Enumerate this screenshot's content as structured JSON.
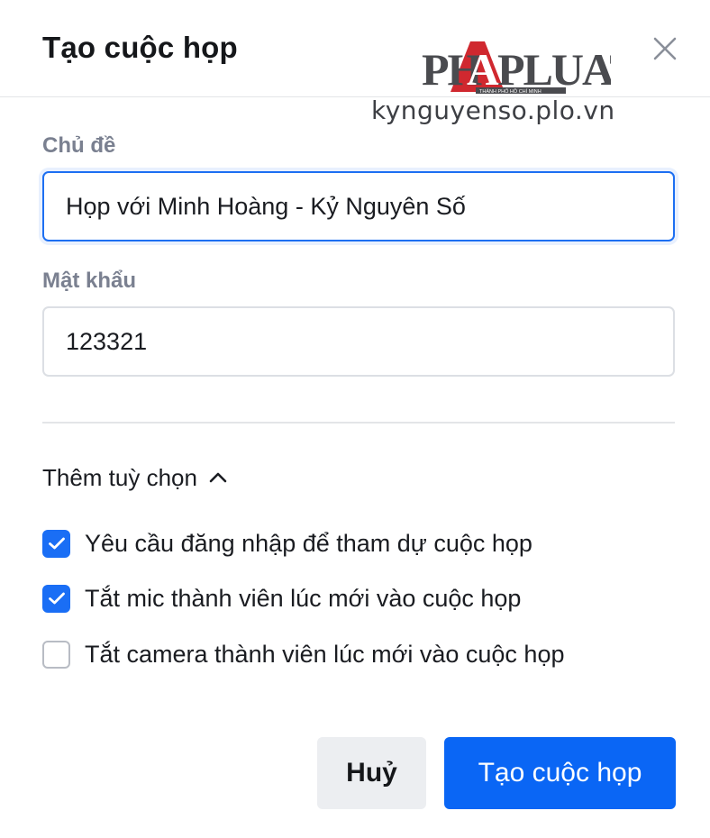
{
  "dialog": {
    "title": "Tạo cuộc họp",
    "close_icon": "close-icon"
  },
  "watermark": {
    "logo_text": "PHÁPLUẬT",
    "logo_subtext": "THÀNH PHỐ HỒ CHÍ MINH",
    "url": "kynguyenso.plo.vn"
  },
  "form": {
    "topic": {
      "label": "Chủ đề",
      "value": "Họp với Minh Hoàng - Kỷ Nguyên Số"
    },
    "password": {
      "label": "Mật khẩu",
      "value": "123321"
    }
  },
  "more_options": {
    "label": "Thêm tuỳ chọn",
    "icon": "chevron-up-icon",
    "options": [
      {
        "label": "Yêu cầu đăng nhập để tham dự cuộc họp",
        "checked": true
      },
      {
        "label": "Tắt mic thành viên lúc mới vào cuộc họp",
        "checked": true
      },
      {
        "label": "Tắt camera thành viên lúc mới vào cuộc họp",
        "checked": false
      }
    ]
  },
  "actions": {
    "cancel_label": "Huỷ",
    "create_label": "Tạo cuộc họp"
  },
  "colors": {
    "primary": "#0a66f5",
    "checkbox_checked": "#1a6ef5",
    "label_gray": "#7a8090",
    "logo_red": "#c9252c"
  }
}
